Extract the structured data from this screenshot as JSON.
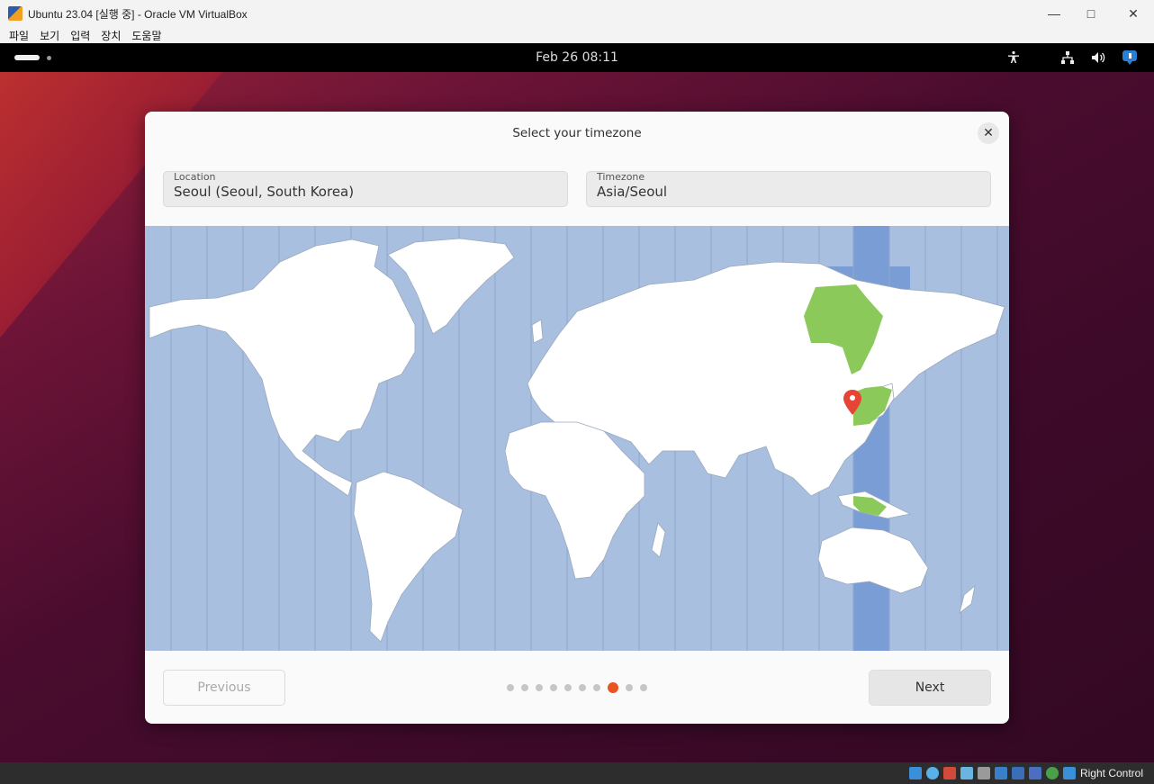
{
  "host": {
    "window_title": "Ubuntu 23.04 [실행 중] - Oracle VM VirtualBox",
    "menu": [
      "파일",
      "보기",
      "입력",
      "장치",
      "도움말"
    ],
    "status_right": "Right Control"
  },
  "guest": {
    "clock": "Feb 26  08:11"
  },
  "dialog": {
    "title": "Select your timezone",
    "location_label": "Location",
    "location_value": "Seoul (Seoul, South Korea)",
    "timezone_label": "Timezone",
    "timezone_value": "Asia/Seoul",
    "previous_label": "Previous",
    "next_label": "Next",
    "progress": {
      "total": 10,
      "current": 8
    }
  },
  "colors": {
    "accent": "#e95420",
    "ocean": "#a9bfe0",
    "selected_band": "#7b9dd6",
    "selected_region": "#8bc95a",
    "land": "#ffffff",
    "pin": "#e64535"
  },
  "icons": [
    "accessibility-icon",
    "network-icon",
    "volume-icon",
    "notification-icon",
    "close-icon",
    "location-pin-icon"
  ]
}
